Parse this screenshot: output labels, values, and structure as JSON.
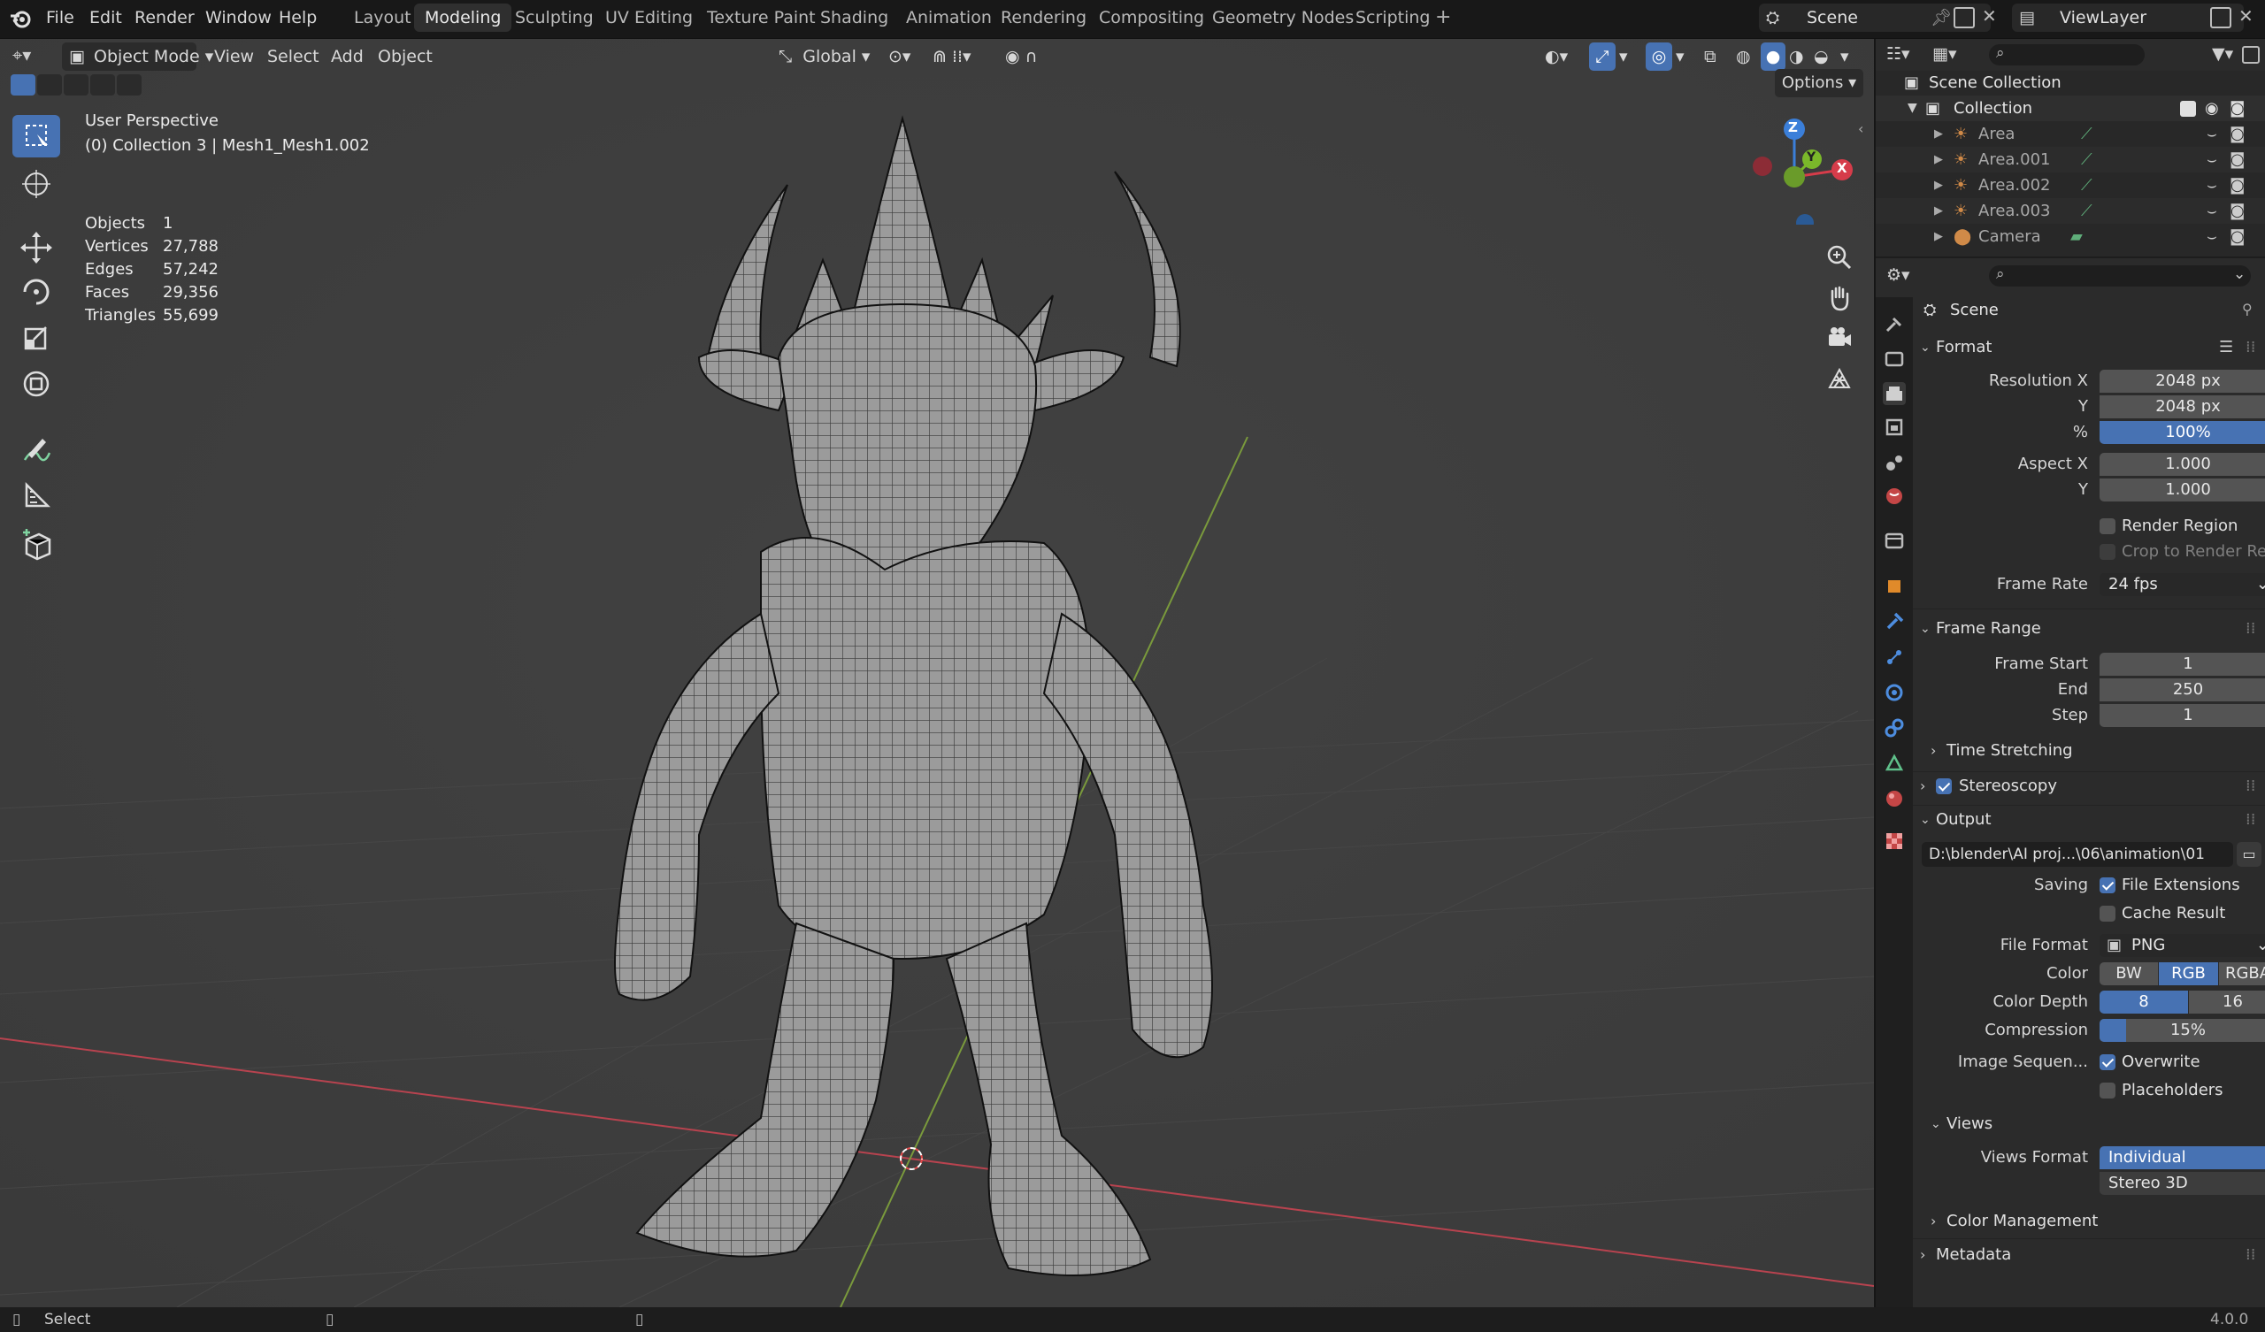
{
  "menu": {
    "file": "File",
    "edit": "Edit",
    "render": "Render",
    "window": "Window",
    "help": "Help"
  },
  "workspaces": [
    "Layout",
    "Modeling",
    "Sculpting",
    "UV Editing",
    "Texture Paint",
    "Shading",
    "Animation",
    "Rendering",
    "Compositing",
    "Geometry Nodes",
    "Scripting"
  ],
  "active_workspace": "Modeling",
  "scene_name": "Scene",
  "view_layer": "ViewLayer",
  "viewport_header": {
    "mode": "Object Mode",
    "view": "View",
    "select": "Select",
    "add": "Add",
    "object": "Object",
    "orientation": "Global",
    "options": "Options"
  },
  "viewport_info": {
    "perspective": "User Perspective",
    "collection": "(0) Collection 3 | Mesh1_Mesh1.002"
  },
  "stats": [
    {
      "label": "Objects",
      "value": "1"
    },
    {
      "label": "Vertices",
      "value": "27,788"
    },
    {
      "label": "Edges",
      "value": "57,242"
    },
    {
      "label": "Faces",
      "value": "29,356"
    },
    {
      "label": "Triangles",
      "value": "55,699"
    }
  ],
  "gizmo": {
    "z": "Z",
    "y": "Y",
    "x": "X"
  },
  "outliner": {
    "scene_collection": "Scene Collection",
    "collection": "Collection",
    "items": [
      "Area",
      "Area.001",
      "Area.002",
      "Area.003",
      "Camera"
    ]
  },
  "properties": {
    "context": "Scene",
    "format": {
      "title": "Format",
      "resolution_x_label": "Resolution X",
      "resolution_x": "2048 px",
      "y_label": "Y",
      "resolution_y": "2048 px",
      "pct_label": "%",
      "pct": "100%",
      "aspect_x_label": "Aspect X",
      "aspect_x": "1.000",
      "aspect_y_label": "Y",
      "aspect_y": "1.000",
      "render_region": "Render Region",
      "crop": "Crop to Render Reg...",
      "frame_rate_label": "Frame Rate",
      "frame_rate": "24 fps"
    },
    "frame_range": {
      "title": "Frame Range",
      "start_label": "Frame Start",
      "start": "1",
      "end_label": "End",
      "end": "250",
      "step_label": "Step",
      "step": "1",
      "time_stretching": "Time Stretching"
    },
    "stereoscopy": "Stereoscopy",
    "output": {
      "title": "Output",
      "path": "D:\\blender\\AI proj...\\06\\animation\\01",
      "saving_label": "Saving",
      "file_extensions": "File Extensions",
      "cache_result": "Cache Result",
      "file_format_label": "File Format",
      "file_format": "PNG",
      "color_label": "Color",
      "color_bw": "BW",
      "color_rgb": "RGB",
      "color_rgba": "RGBA",
      "depth_label": "Color Depth",
      "depth_8": "8",
      "depth_16": "16",
      "compression_label": "Compression",
      "compression": "15%",
      "image_seq_label": "Image Sequen...",
      "overwrite": "Overwrite",
      "placeholders": "Placeholders"
    },
    "views": {
      "title": "Views",
      "format_label": "Views Format",
      "individual": "Individual",
      "stereo3d": "Stereo 3D"
    },
    "color_management": "Color Management",
    "metadata": "Metadata"
  },
  "statusbar": {
    "select": "Select",
    "version": "4.0.0"
  },
  "colors": {
    "accent": "#4772b3",
    "x_axis": "#d63c4a",
    "y_axis": "#7ab82a",
    "z_axis": "#3b7fd9"
  }
}
